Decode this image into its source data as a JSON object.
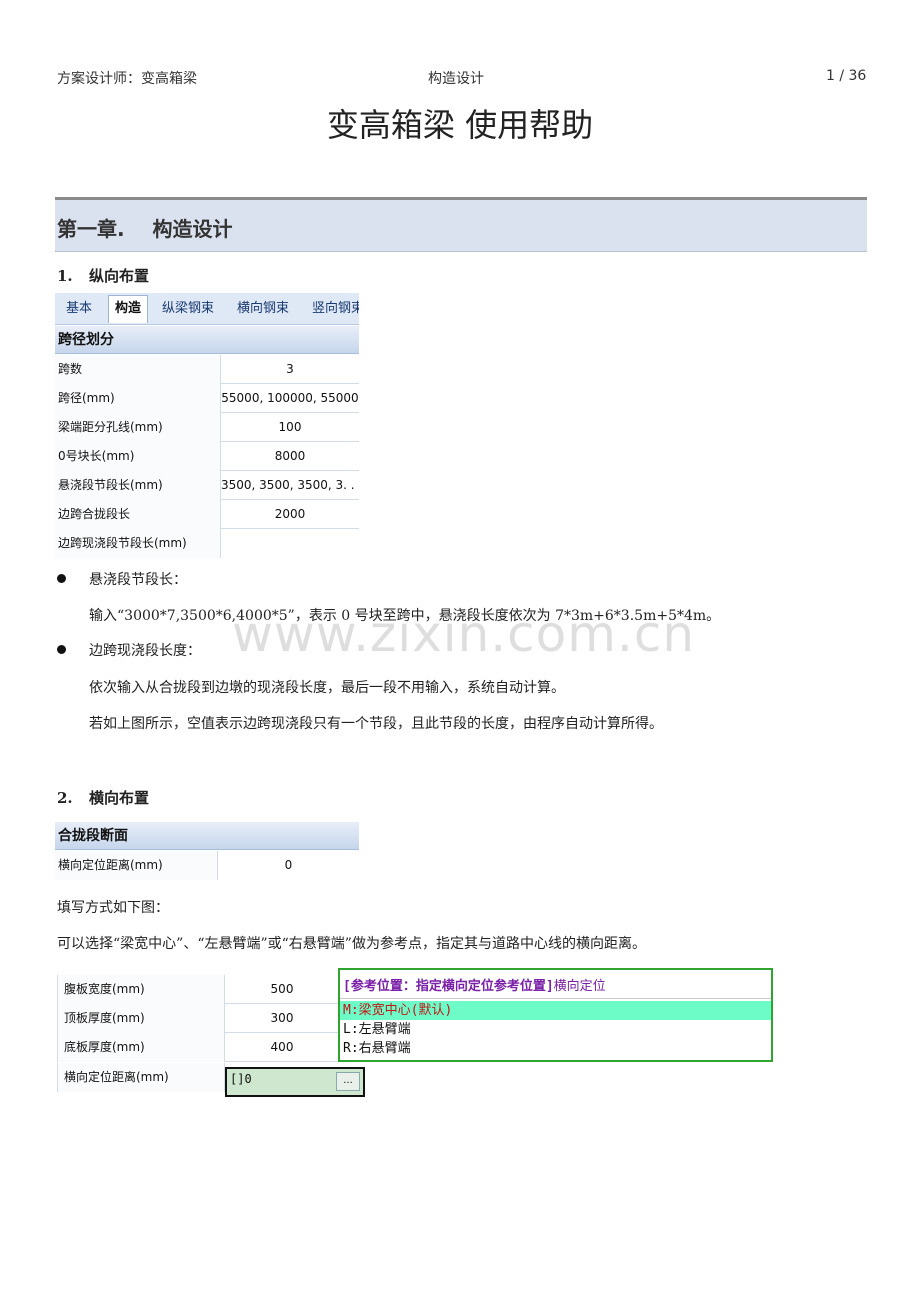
{
  "header": {
    "left": "方案设计师：变高箱梁",
    "center": "构造设计",
    "right": "1 / 36"
  },
  "title": "变高箱梁 使用帮助",
  "chapter": "第一章.    构造设计",
  "section1": {
    "num": "1.",
    "title": "纵向布置"
  },
  "panel1": {
    "tabs": [
      "基本",
      "构造",
      "纵梁钢束",
      "横向钢束",
      "竖向钢束"
    ],
    "group": "跨径划分",
    "rows": [
      {
        "k": "跨数",
        "v": "3"
      },
      {
        "k": "跨径(mm)",
        "v": "55000, 100000, 55000"
      },
      {
        "k": "梁端距分孔线(mm)",
        "v": "100"
      },
      {
        "k": "0号块长(mm)",
        "v": "8000"
      },
      {
        "k": "悬浇段节段长(mm)",
        "v": "3500, 3500, 3500, 3. . ."
      },
      {
        "k": "边跨合拢段长",
        "v": "2000"
      },
      {
        "k": "边跨现浇段节段长(mm)",
        "v": ""
      }
    ]
  },
  "bullets": [
    {
      "title": "悬浇段节段长：",
      "text": "输入“3000*7,3500*6,4000*5”，表示 0 号块至跨中，悬浇段长度依次为 7*3m+6*3.5m+5*4m。"
    },
    {
      "title": "边跨现浇段长度：",
      "text1": "依次输入从合拢段到边墩的现浇段长度，最后一段不用输入，系统自动计算。",
      "text2": "若如上图所示，空值表示边跨现浇段只有一个节段，且此节段的长度，由程序自动计算所得。"
    }
  ],
  "watermark": "www.zixin.com.cn",
  "section2": {
    "num": "2.",
    "title": "横向布置"
  },
  "panel2": {
    "group": "合拢段断面",
    "rows": [
      {
        "k": "横向定位距离(mm)",
        "v": "0"
      }
    ]
  },
  "para1": "填写方式如下图：",
  "para2": "可以选择“梁宽中心”、“左悬臂端”或“右悬臂端”做为参考点，指定其与道路中心线的横向距离。",
  "panel3": {
    "rows": [
      {
        "k": "腹板宽度(mm)",
        "v": "500"
      },
      {
        "k": "顶板厚度(mm)",
        "v": "300"
      },
      {
        "k": "底板厚度(mm)",
        "v": "400"
      },
      {
        "k": "横向定位距离(mm)",
        "v": ""
      }
    ],
    "input_value": "[]0",
    "button": "...",
    "popup": {
      "header_bold": "[参考位置：指定横向定位参考位置]",
      "header_rest": "横向定位",
      "options": [
        "M:梁宽中心(默认)",
        "L:左悬臂端",
        "R:右悬臂端"
      ]
    }
  }
}
